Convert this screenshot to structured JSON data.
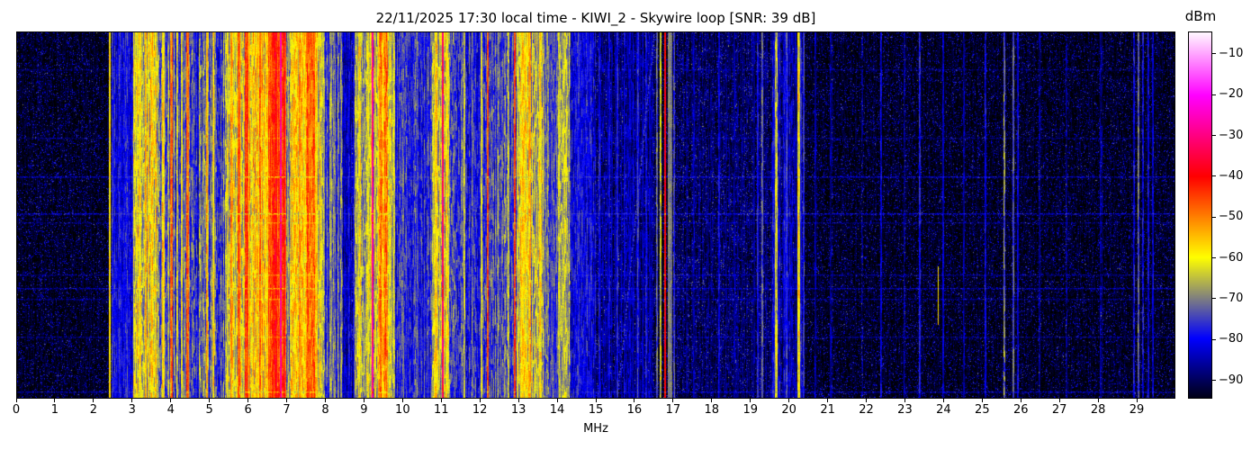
{
  "chart_data": {
    "type": "heatmap",
    "title": "22/11/2025 17:30 local time - KIWI_2 - Skywire loop [SNR: 39 dB]",
    "xlabel": "MHz",
    "x_range": [
      0,
      30
    ],
    "x_ticks": [
      0,
      1,
      2,
      3,
      4,
      5,
      6,
      7,
      8,
      9,
      10,
      11,
      12,
      13,
      14,
      15,
      16,
      17,
      18,
      19,
      20,
      21,
      22,
      23,
      24,
      25,
      26,
      27,
      28,
      29
    ],
    "y_axis": "time (no ticks shown)",
    "grid": false,
    "noise_floor_dbm": -94,
    "colorbar": {
      "label": "dBm",
      "ticks": [
        -10,
        -20,
        -30,
        -40,
        -50,
        -60,
        -70,
        -80,
        -90
      ],
      "range": [
        -94.5,
        -4.5
      ],
      "gradient_stops": [
        {
          "v": -96,
          "c": [
            0,
            0,
            0
          ]
        },
        {
          "v": -80,
          "c": [
            0,
            0,
            255
          ]
        },
        {
          "v": -60,
          "c": [
            255,
            255,
            0
          ]
        },
        {
          "v": -50,
          "c": [
            255,
            128,
            0
          ]
        },
        {
          "v": -40,
          "c": [
            255,
            0,
            0
          ]
        },
        {
          "v": -20,
          "c": [
            255,
            0,
            255
          ]
        },
        {
          "v": -4,
          "c": [
            255,
            255,
            255
          ]
        }
      ]
    },
    "bands": [
      {
        "f0": 2.45,
        "f1": 3.02,
        "level": -80,
        "cvar": 4,
        "tvar": 5
      },
      {
        "f0": 3.02,
        "f1": 3.3,
        "level": -63,
        "cvar": 7,
        "tvar": 7
      },
      {
        "f0": 3.3,
        "f1": 3.65,
        "level": -62,
        "cvar": 8,
        "tvar": 7
      },
      {
        "f0": 3.65,
        "f1": 4.2,
        "level": -70,
        "cvar": 9,
        "tvar": 7
      },
      {
        "f0": 4.2,
        "f1": 4.6,
        "level": -72,
        "cvar": 8,
        "tvar": 7
      },
      {
        "f0": 4.6,
        "f1": 5.4,
        "level": -73,
        "cvar": 8,
        "tvar": 7
      },
      {
        "f0": 5.4,
        "f1": 5.9,
        "level": -62,
        "cvar": 7,
        "tvar": 7
      },
      {
        "f0": 5.9,
        "f1": 6.5,
        "level": -56,
        "cvar": 7,
        "tvar": 6
      },
      {
        "f0": 6.5,
        "f1": 6.98,
        "level": -45,
        "cvar": 4,
        "tvar": 5
      },
      {
        "f0": 6.98,
        "f1": 7.1,
        "level": -68,
        "cvar": 6,
        "tvar": 6
      },
      {
        "f0": 7.1,
        "f1": 7.45,
        "level": -60,
        "cvar": 7,
        "tvar": 7
      },
      {
        "f0": 7.45,
        "f1": 7.8,
        "level": -50,
        "cvar": 6,
        "tvar": 6
      },
      {
        "f0": 7.8,
        "f1": 7.95,
        "level": -61,
        "cvar": 6,
        "tvar": 6
      },
      {
        "f0": 7.95,
        "f1": 8.45,
        "level": -74,
        "cvar": 7,
        "tvar": 6
      },
      {
        "f0": 8.45,
        "f1": 8.75,
        "level": -84,
        "cvar": 5,
        "tvar": 5
      },
      {
        "f0": 8.75,
        "f1": 9.35,
        "level": -63,
        "cvar": 7,
        "tvar": 7
      },
      {
        "f0": 9.35,
        "f1": 9.6,
        "level": -53,
        "cvar": 6,
        "tvar": 6
      },
      {
        "f0": 9.6,
        "f1": 9.8,
        "level": -64,
        "cvar": 6,
        "tvar": 6
      },
      {
        "f0": 9.8,
        "f1": 10.75,
        "level": -77,
        "cvar": 5,
        "tvar": 6
      },
      {
        "f0": 10.75,
        "f1": 11.2,
        "level": -63,
        "cvar": 7,
        "tvar": 7
      },
      {
        "f0": 11.2,
        "f1": 12.1,
        "level": -76,
        "cvar": 6,
        "tvar": 7
      },
      {
        "f0": 12.1,
        "f1": 12.95,
        "level": -74,
        "cvar": 6,
        "tvar": 7
      },
      {
        "f0": 12.95,
        "f1": 13.65,
        "level": -63,
        "cvar": 7,
        "tvar": 7
      },
      {
        "f0": 13.65,
        "f1": 14.0,
        "level": -76,
        "cvar": 5,
        "tvar": 6
      },
      {
        "f0": 14.0,
        "f1": 14.35,
        "level": -69,
        "cvar": 6,
        "tvar": 7
      },
      {
        "f0": 14.35,
        "f1": 15.0,
        "level": -81,
        "cvar": 5,
        "tvar": 6
      },
      {
        "f0": 15.0,
        "f1": 16.55,
        "level": -87,
        "cvar": 4,
        "tvar": 5
      },
      {
        "f0": 17.05,
        "f1": 19.55,
        "level": -90,
        "cvar": 3,
        "tvar": 4
      },
      {
        "f0": 19.55,
        "f1": 20.4,
        "level": -84,
        "cvar": 5,
        "tvar": 6
      }
    ],
    "stripes": [
      {
        "f": 2.4,
        "level": -59
      },
      {
        "f": 3.2,
        "level": -57
      },
      {
        "f": 3.33,
        "level": -55
      },
      {
        "f": 3.48,
        "level": -57
      },
      {
        "f": 3.79,
        "level": -56
      },
      {
        "f": 4.0,
        "w": 0.07,
        "level": -48
      },
      {
        "f": 4.27,
        "level": -60
      },
      {
        "f": 4.42,
        "level": -46
      },
      {
        "f": 4.93,
        "level": -53
      },
      {
        "f": 5.08,
        "level": -58
      },
      {
        "f": 5.55,
        "level": -51
      },
      {
        "f": 5.75,
        "w": 0.06,
        "level": -47
      },
      {
        "f": 5.95,
        "w": 0.08,
        "level": -44
      },
      {
        "f": 6.3,
        "w": 0.06,
        "level": -46
      },
      {
        "f": 6.7,
        "w": 0.1,
        "level": -41
      },
      {
        "f": 6.84,
        "w": 0.035,
        "level": -27,
        "tvar": 3
      },
      {
        "f": 6.92,
        "w": 0.05,
        "level": -42
      },
      {
        "f": 7.2,
        "level": -55
      },
      {
        "f": 7.33,
        "level": -51
      },
      {
        "f": 7.55,
        "w": 0.07,
        "level": -45
      },
      {
        "f": 7.68,
        "w": 0.06,
        "level": -47
      },
      {
        "f": 8.15,
        "level": -66
      },
      {
        "f": 8.24,
        "level": -69
      },
      {
        "f": 9.0,
        "level": -70
      },
      {
        "f": 9.1,
        "level": -59
      },
      {
        "f": 9.21,
        "w": 0.035,
        "level": -29,
        "tvar": 3
      },
      {
        "f": 9.42,
        "w": 0.06,
        "level": -47
      },
      {
        "f": 10.0,
        "level": -73
      },
      {
        "f": 10.35,
        "level": -74
      },
      {
        "f": 10.88,
        "level": -56
      },
      {
        "f": 11.04,
        "w": 0.04,
        "level": -33,
        "tvar": 4
      },
      {
        "f": 11.12,
        "level": -58
      },
      {
        "f": 11.6,
        "level": -64
      },
      {
        "f": 11.8,
        "level": -72
      },
      {
        "f": 12.04,
        "level": -63
      },
      {
        "f": 12.21,
        "w": 0.05,
        "level": -47
      },
      {
        "f": 12.45,
        "level": -70
      },
      {
        "f": 12.74,
        "level": -64
      },
      {
        "f": 12.91,
        "w": 0.05,
        "level": -45
      },
      {
        "f": 13.1,
        "level": -56
      },
      {
        "f": 13.28,
        "w": 0.06,
        "level": -53
      },
      {
        "f": 13.55,
        "level": -57
      },
      {
        "f": 13.75,
        "level": -70
      },
      {
        "f": 13.88,
        "level": -73
      },
      {
        "f": 14.07,
        "level": -65
      },
      {
        "f": 14.17,
        "level": -63
      },
      {
        "f": 14.28,
        "level": -69
      },
      {
        "f": 14.55,
        "level": -76
      },
      {
        "f": 14.7,
        "level": -79
      },
      {
        "f": 14.85,
        "level": -81
      },
      {
        "f": 15.1,
        "level": -79
      },
      {
        "f": 15.35,
        "level": -81
      },
      {
        "f": 15.55,
        "level": -78
      },
      {
        "f": 15.75,
        "level": -81
      },
      {
        "f": 16.1,
        "level": -77
      },
      {
        "f": 16.3,
        "level": -80
      },
      {
        "f": 16.58,
        "level": -73
      },
      {
        "f": 16.68,
        "level": -63,
        "tvar": 8
      },
      {
        "f": 16.79,
        "w": 0.05,
        "level": -40,
        "tvar": 3
      },
      {
        "f": 16.93,
        "w": 0.12,
        "level": -70,
        "tvar": 2
      },
      {
        "f": 17.03,
        "level": -76
      },
      {
        "f": 17.55,
        "level": -85
      },
      {
        "f": 18.2,
        "level": -81
      },
      {
        "f": 18.6,
        "level": -86
      },
      {
        "f": 19.2,
        "level": -79
      },
      {
        "f": 19.31,
        "level": -74
      },
      {
        "f": 19.68,
        "w": 0.08,
        "level": -64,
        "tvar": 7
      },
      {
        "f": 19.95,
        "level": -75
      },
      {
        "f": 20.27,
        "w": 0.07,
        "level": -59,
        "tvar": 7
      },
      {
        "f": 20.38,
        "level": -76
      },
      {
        "f": 20.7,
        "level": -85
      },
      {
        "f": 21.1,
        "level": -88
      },
      {
        "f": 21.9,
        "level": -89
      },
      {
        "f": 22.4,
        "level": -84
      },
      {
        "f": 23.0,
        "level": -87
      },
      {
        "f": 23.4,
        "level": -80
      },
      {
        "f": 24.0,
        "level": -85
      },
      {
        "f": 24.55,
        "level": -87
      },
      {
        "f": 25.1,
        "level": -83
      },
      {
        "f": 25.6,
        "level": -69,
        "tvar": 8
      },
      {
        "f": 25.82,
        "level": -74
      },
      {
        "f": 25.95,
        "level": -81
      },
      {
        "f": 26.5,
        "level": -87
      },
      {
        "f": 27.2,
        "level": -89
      },
      {
        "f": 28.1,
        "level": -88
      },
      {
        "f": 28.95,
        "level": -81,
        "tvar": 7
      },
      {
        "f": 29.06,
        "w": 0.04,
        "level": -71,
        "tvar": 6
      },
      {
        "f": 29.18,
        "level": -79,
        "tvar": 7
      },
      {
        "f": 29.32,
        "level": -81,
        "tvar": 7
      },
      {
        "f": 29.45,
        "level": -83
      }
    ],
    "h_lines": [
      {
        "y": 0.1,
        "s": 0.25
      },
      {
        "y": 0.29,
        "s": 0.25
      },
      {
        "y": 0.395,
        "s": 0.55
      },
      {
        "y": 0.497,
        "s": 0.6
      },
      {
        "y": 0.52,
        "s": 0.3
      },
      {
        "y": 0.665,
        "s": 0.35
      },
      {
        "y": 0.7,
        "s": 0.45
      },
      {
        "y": 0.73,
        "s": 0.3
      },
      {
        "y": 0.835,
        "s": 0.3
      },
      {
        "y": 0.985,
        "s": 0.45
      }
    ],
    "diagonal": {
      "f_top": 16.5,
      "f_bottom": 15.55,
      "level": -78,
      "dash": 0.6
    },
    "short_lines": [
      {
        "f": 23.87,
        "y0": 0.64,
        "y1": 0.8,
        "level": -57
      }
    ]
  }
}
